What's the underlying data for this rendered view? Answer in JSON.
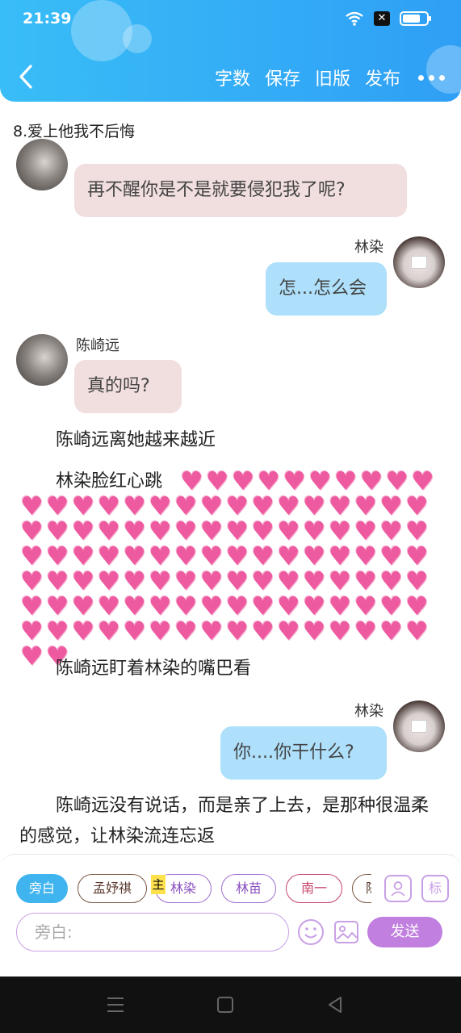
{
  "status_bar": {
    "time": "21:39",
    "battery_level": 0.75
  },
  "header": {
    "back_icon": "chevron-left-icon",
    "actions": [
      "字数",
      "保存",
      "旧版",
      "发布"
    ],
    "more_icon": "more-horizontal-icon",
    "background_color": "#2fa8f6"
  },
  "chapter_title": "8.爱上他我不后悔",
  "messages": [
    {
      "speaker": "",
      "text": "再不醒你是不是就要侵犯我了呢?",
      "side": "left",
      "bubble_color": "#f1dede"
    },
    {
      "speaker": "林染",
      "text": "怎...怎么会",
      "side": "right",
      "bubble_color": "#aee0fb"
    },
    {
      "speaker": "陈崎远",
      "text": "真的吗?",
      "side": "left",
      "bubble_color": "#f1dede"
    },
    {
      "narration": "陈崎远离她越来越近"
    },
    {
      "narration": "林染脸红心跳",
      "hearts_count": 108
    },
    {
      "narration": "陈崎远盯着林染的嘴巴看"
    },
    {
      "speaker": "林染",
      "text": "你....你干什么?",
      "side": "right",
      "bubble_color": "#aee0fb"
    },
    {
      "narration": "陈崎远没有说话，而是亲了上去，是那种很温柔的感觉，让林染流连忘返"
    }
  ],
  "composer": {
    "roles": [
      {
        "label": "旁白",
        "style": "active"
      },
      {
        "label": "孟妤祺",
        "style": "brown"
      },
      {
        "label": "林染",
        "style": "purple",
        "tag": "主"
      },
      {
        "label": "林苗",
        "style": "purple"
      },
      {
        "label": "南一",
        "style": "red"
      },
      {
        "label": "陈",
        "style": "brown"
      }
    ],
    "role_icon": "user-card-icon",
    "mark_button": "标",
    "input_placeholder": "旁白:",
    "emoji_icon": "smile-icon",
    "image_icon": "image-icon",
    "send_label": "发送",
    "accent_color": "#c17fe0"
  },
  "nav_bar": {
    "icons": [
      "menu-icon",
      "home-square-icon",
      "back-triangle-icon"
    ]
  }
}
